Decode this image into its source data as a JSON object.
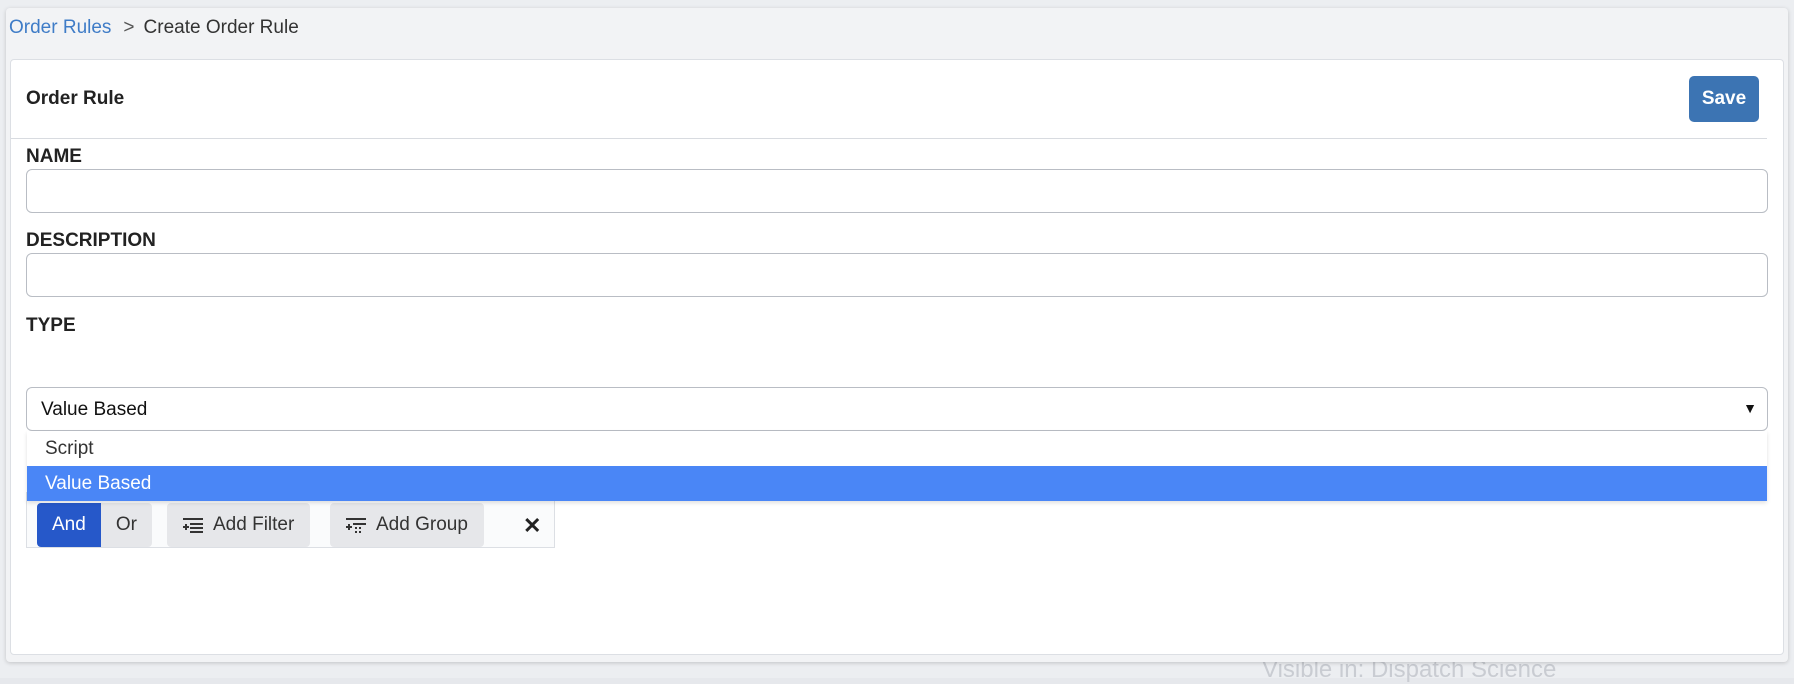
{
  "breadcrumb": {
    "parent": "Order Rules",
    "separator": ">",
    "current": "Create Order Rule"
  },
  "card": {
    "title": "Order Rule",
    "save_label": "Save"
  },
  "form": {
    "name_label": "NAME",
    "name_value": "",
    "description_label": "DESCRIPTION",
    "description_value": "",
    "type_label": "TYPE",
    "type_value": "Value Based",
    "type_options": [
      "Script",
      "Value Based"
    ]
  },
  "query_builder": {
    "and_label": "And",
    "or_label": "Or",
    "add_filter_label": "Add Filter",
    "add_group_label": "Add Group",
    "remove_symbol": "✕"
  },
  "background": {
    "faded_text": "Visible in: Dispatch Science"
  },
  "colors": {
    "accent": "#3c74b3",
    "link": "#3f7cc7",
    "selected_option": "#4a86f6",
    "active_combinator": "#2658c9"
  }
}
